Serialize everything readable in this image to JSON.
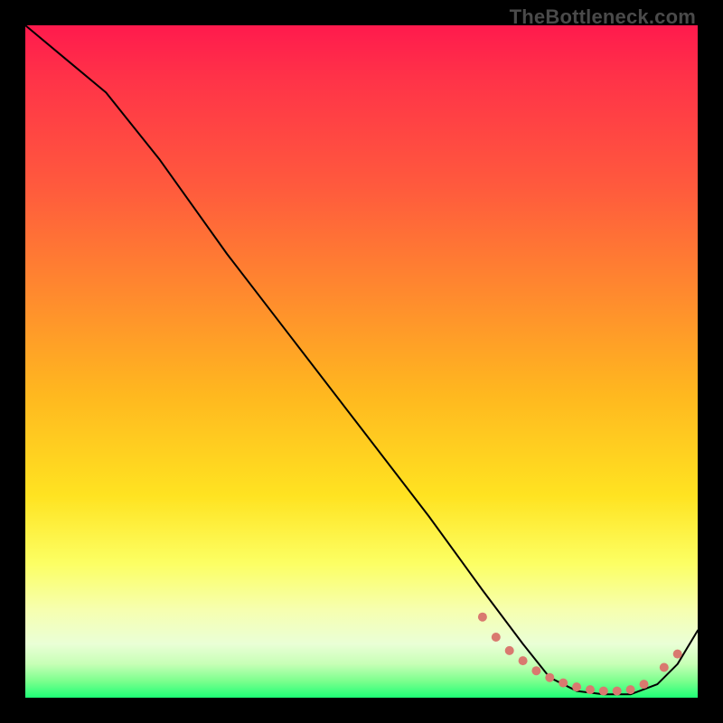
{
  "watermark": "TheBottleneck.com",
  "chart_data": {
    "type": "line",
    "title": "",
    "xlabel": "",
    "ylabel": "",
    "xlim": [
      0,
      100
    ],
    "ylim": [
      0,
      100
    ],
    "grid": false,
    "series": [
      {
        "name": "curve",
        "stroke": "#000000",
        "x": [
          0,
          6,
          12,
          20,
          30,
          40,
          50,
          60,
          68,
          74,
          78,
          82,
          86,
          90,
          94,
          97,
          100
        ],
        "values": [
          100,
          95,
          90,
          80,
          66,
          53,
          40,
          27,
          16,
          8,
          3,
          1,
          0.5,
          0.5,
          2,
          5,
          10
        ]
      }
    ],
    "markers": {
      "name": "dots",
      "color": "#d9796f",
      "x": [
        68,
        70,
        72,
        74,
        76,
        78,
        80,
        82,
        84,
        86,
        88,
        90,
        92,
        95,
        97
      ],
      "values": [
        12,
        9,
        7,
        5.5,
        4,
        3,
        2.2,
        1.6,
        1.2,
        1,
        1,
        1.2,
        2,
        4.5,
        6.5
      ]
    }
  }
}
